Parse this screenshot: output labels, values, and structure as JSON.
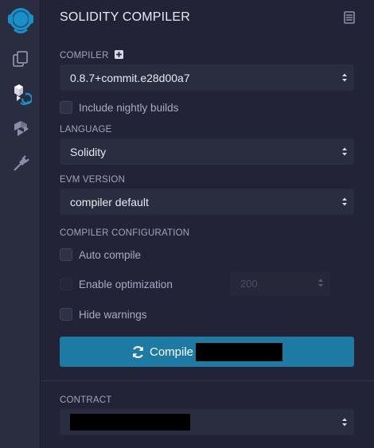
{
  "sidebar": {
    "items": [
      {
        "name": "remix-logo-icon"
      },
      {
        "name": "file-explorer-icon"
      },
      {
        "name": "solidity-compiler-icon"
      },
      {
        "name": "deploy-run-icon"
      },
      {
        "name": "plugin-manager-icon"
      }
    ]
  },
  "panel": {
    "title": "SOLIDITY COMPILER"
  },
  "compiler": {
    "label": "COMPILER",
    "version": "0.8.7+commit.e28d00a7"
  },
  "nightly": {
    "label": "Include nightly builds",
    "checked": false
  },
  "language": {
    "label": "LANGUAGE",
    "value": "Solidity"
  },
  "evm": {
    "label": "EVM VERSION",
    "value": "compiler default"
  },
  "config": {
    "label": "COMPILER CONFIGURATION",
    "auto_compile": "Auto compile",
    "enable_optimization": "Enable optimization",
    "runs": "200",
    "hide_warnings": "Hide warnings"
  },
  "compile_button": {
    "label": "Compile"
  },
  "contract": {
    "label": "CONTRACT"
  },
  "colors": {
    "background": "#222336",
    "rail": "#2a2c3f",
    "accent": "#1d7aa3",
    "logo": "#1c8fc8"
  }
}
